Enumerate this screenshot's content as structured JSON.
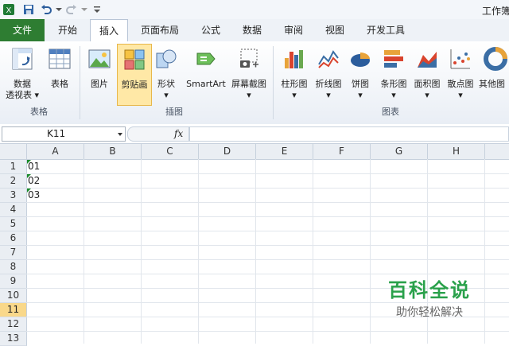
{
  "window": {
    "title": "工作簿"
  },
  "tabs": [
    {
      "label": "文件"
    },
    {
      "label": "开始"
    },
    {
      "label": "插入"
    },
    {
      "label": "页面布局"
    },
    {
      "label": "公式"
    },
    {
      "label": "数据"
    },
    {
      "label": "审阅"
    },
    {
      "label": "视图"
    },
    {
      "label": "开发工具"
    }
  ],
  "ribbon": {
    "buttons": [
      {
        "label": "数据\n透视表 ▾"
      },
      {
        "label": "表格"
      },
      {
        "label": "图片"
      },
      {
        "label": "剪贴画"
      },
      {
        "label": "形状\n▾"
      },
      {
        "label": "SmartArt"
      },
      {
        "label": "屏幕截图\n▾"
      },
      {
        "label": "柱形图\n▾"
      },
      {
        "label": "折线图\n▾"
      },
      {
        "label": "饼图\n▾"
      },
      {
        "label": "条形图\n▾"
      },
      {
        "label": "面积图\n▾"
      },
      {
        "label": "散点图\n▾"
      },
      {
        "label": "其他图"
      }
    ],
    "groups": [
      {
        "label": "表格"
      },
      {
        "label": "插图"
      },
      {
        "label": "图表"
      }
    ]
  },
  "formula_bar": {
    "name_box": "K11",
    "fx": "fx",
    "value": ""
  },
  "sheet": {
    "columns": [
      "A",
      "B",
      "C",
      "D",
      "E",
      "F",
      "G",
      "H"
    ],
    "rows": [
      "1",
      "2",
      "3",
      "4",
      "5",
      "6",
      "7",
      "8",
      "9",
      "10",
      "11",
      "12",
      "13"
    ],
    "active_row": "11",
    "cells": [
      {
        "ref": "A1",
        "value": "01"
      },
      {
        "ref": "A2",
        "value": "02"
      },
      {
        "ref": "A3",
        "value": "03"
      }
    ]
  },
  "watermark": {
    "line1": "百科全说",
    "line2": "助你轻松解决"
  },
  "colors": {
    "accent": "#2e7d32",
    "selected_fill": "#ffe8a6",
    "active_row": "#f9d88a",
    "watermark_green": "#2aa14b"
  }
}
